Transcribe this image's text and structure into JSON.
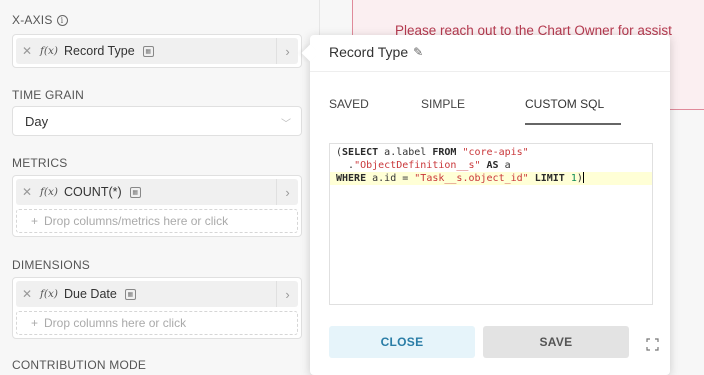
{
  "xaxis": {
    "label": "X-AXIS",
    "info_glyph": "i",
    "item_label": "Record Type",
    "fx_glyph": "f(x)"
  },
  "time_grain": {
    "label": "TIME GRAIN",
    "value": "Day"
  },
  "metrics": {
    "label": "METRICS",
    "item_label": "COUNT(*)",
    "drop_hint": "Drop columns/metrics here or click"
  },
  "dimensions": {
    "label": "DIMENSIONS",
    "item_label": "Due Date",
    "drop_hint": "Drop columns here or click"
  },
  "contribution": {
    "label": "CONTRIBUTION MODE"
  },
  "chart_message": {
    "text": "Please reach out to the Chart Owner for assist"
  },
  "popover": {
    "title": "Record Type",
    "tabs": [
      "SAVED",
      "SIMPLE",
      "CUSTOM SQL"
    ],
    "active_tab": "CUSTOM SQL",
    "sql": {
      "l1_a": "(",
      "l1_kw1": "SELECT",
      "l1_b": " a.label ",
      "l1_kw2": "FROM",
      "l1_c": " ",
      "l1_str": "\"core-apis\"",
      "l2_a": "  .",
      "l2_str": "\"ObjectDefinition__s\"",
      "l2_b": " ",
      "l2_kw": "AS",
      "l2_c": " a",
      "l3_kw1": "WHERE",
      "l3_a": " a.id = ",
      "l3_str": "\"Task__s.object_id\"",
      "l3_b": " ",
      "l3_kw2": "LIMIT",
      "l3_c": " ",
      "l3_num": "1",
      "l3_d": ")"
    },
    "close_label": "CLOSE",
    "save_label": "SAVE"
  },
  "icons": {
    "remove": "close-icon",
    "arrow": "chevron-right-icon",
    "dropdown": "chevron-down-icon",
    "edit": "pencil-icon",
    "expand": "expand-icon"
  },
  "colors": {
    "error_text": "#b43a4f",
    "error_bg": "#fbeff1",
    "close_btn_text": "#2a7da6"
  }
}
